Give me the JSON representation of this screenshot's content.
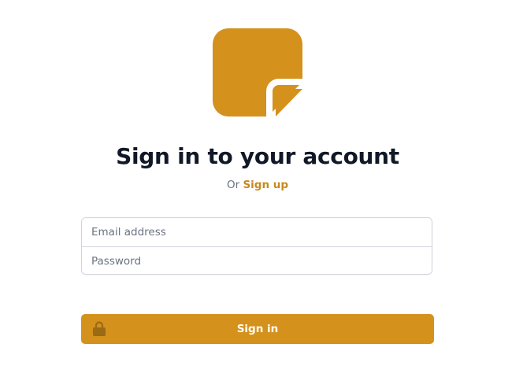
{
  "header": {
    "title": "Sign in to your account",
    "subtitle_prefix": "Or",
    "signup_link": "Sign up"
  },
  "form": {
    "email_placeholder": "Email address",
    "password_placeholder": "Password",
    "email_value": "",
    "password_value": "",
    "submit_label": "Sign in"
  },
  "icons": {
    "logo": "sticky-note-icon",
    "submit": "lock-icon"
  },
  "colors": {
    "accent": "#d4911c",
    "link": "#c9891c",
    "title": "#111827",
    "muted": "#6b7280",
    "border": "#d1d5db"
  }
}
